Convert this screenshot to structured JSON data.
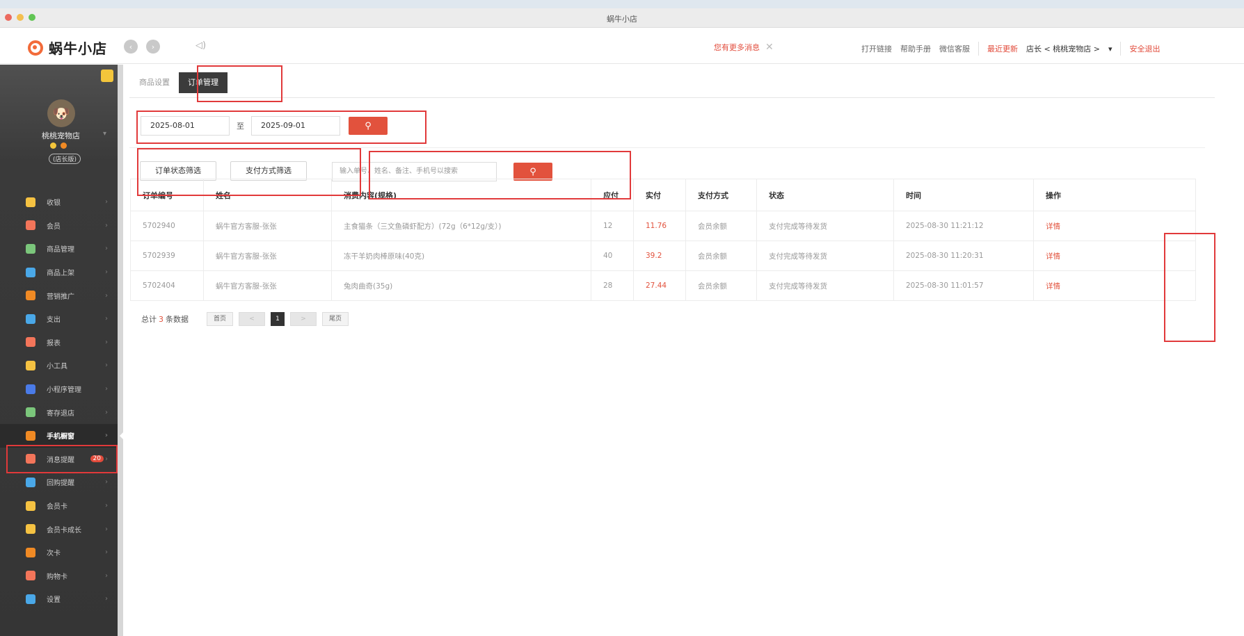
{
  "window": {
    "title": "蜗牛小店"
  },
  "app": {
    "logo_text": "蜗牛小店",
    "notice": "您有更多消息",
    "links": [
      "打开链接",
      "帮助手册",
      "微信客服"
    ],
    "recent_update": "最近更新",
    "store_label": "店长 < 桃桃宠物店 >",
    "logout": "安全退出"
  },
  "sidebar": {
    "shop_name": "桃桃宠物店",
    "grade": "(店长版)",
    "items": [
      {
        "label": "收银",
        "color": "#f5c242"
      },
      {
        "label": "会员",
        "color": "#f3755a"
      },
      {
        "label": "商品管理",
        "color": "#7bc67b"
      },
      {
        "label": "商品上架",
        "color": "#4aa8e8"
      },
      {
        "label": "营销推广",
        "color": "#f08a24"
      },
      {
        "label": "支出",
        "color": "#4aa8e8"
      },
      {
        "label": "报表",
        "color": "#f3755a"
      },
      {
        "label": "小工具",
        "color": "#f5c242"
      },
      {
        "label": "小程序管理",
        "color": "#4a7be8"
      },
      {
        "label": "寄存退店",
        "color": "#7bc67b"
      },
      {
        "label": "手机橱窗",
        "color": "#f08a24"
      },
      {
        "label": "消息提醒",
        "color": "#f3755a",
        "badge": "20"
      },
      {
        "label": "回购提醒",
        "color": "#4aa8e8"
      },
      {
        "label": "会员卡",
        "color": "#f5c242"
      },
      {
        "label": "会员卡成长",
        "color": "#f5c242"
      },
      {
        "label": "次卡",
        "color": "#f08a24"
      },
      {
        "label": "购物卡",
        "color": "#f3755a"
      },
      {
        "label": "设置",
        "color": "#4aa8e8"
      }
    ],
    "active_index": 10
  },
  "tabs": [
    {
      "label": "商品设置"
    },
    {
      "label": "订单管理"
    }
  ],
  "filters": {
    "date_from": "2025-08-01",
    "date_to_sep": "至",
    "date_to": "2025-09-01",
    "status_filter": "订单状态筛选",
    "pay_filter": "支付方式筛选",
    "search_placeholder": "输入单号、姓名、备注、手机号以搜索"
  },
  "table": {
    "columns": [
      "订单编号",
      "姓名",
      "消费内容(规格)",
      "应付",
      "实付",
      "支付方式",
      "状态",
      "时间",
      "操作"
    ],
    "rows": [
      {
        "id": "5702940",
        "name": "蜗牛官方客服-张张",
        "content": "主食猫条（三文鱼磷虾配方）(72g（6*12g/支）)",
        "due": "12",
        "paid": "11.76",
        "method": "会员余额",
        "status": "支付完成等待发货",
        "time": "2025-08-30 11:21:12",
        "op": "详情"
      },
      {
        "id": "5702939",
        "name": "蜗牛官方客服-张张",
        "content": "冻干羊奶肉棒原味(40克)",
        "due": "40",
        "paid": "39.2",
        "method": "会员余额",
        "status": "支付完成等待发货",
        "time": "2025-08-30 11:20:31",
        "op": "详情"
      },
      {
        "id": "5702404",
        "name": "蜗牛官方客服-张张",
        "content": "兔肉曲奇(35g)",
        "due": "28",
        "paid": "27.44",
        "method": "会员余额",
        "status": "支付完成等待发货",
        "time": "2025-08-30 11:01:57",
        "op": "详情"
      }
    ]
  },
  "pagination": {
    "total_prefix": "总计",
    "total": "3",
    "total_suffix": "条数据",
    "first": "首页",
    "prev": "<",
    "current": "1",
    "next": ">",
    "last": "尾页"
  }
}
